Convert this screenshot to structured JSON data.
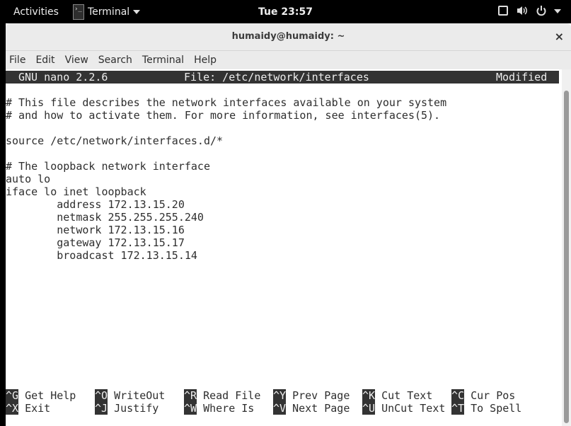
{
  "topbar": {
    "activities": "Activities",
    "app_name": "Terminal",
    "clock": "Tue 23:57",
    "icons": [
      "window-icon",
      "volume-icon",
      "power-icon",
      "dropdown-caret-icon"
    ]
  },
  "window": {
    "title": "humaidy@humaidy: ~",
    "close": "×"
  },
  "menu": [
    "File",
    "Edit",
    "View",
    "Search",
    "Terminal",
    "Help"
  ],
  "nano": {
    "version": "GNU nano 2.2.6",
    "file": "File: /etc/network/interfaces",
    "status": "Modified",
    "lines": [
      "# This file describes the network interfaces available on your system",
      "# and how to activate them. For more information, see interfaces(5).",
      "",
      "source /etc/network/interfaces.d/*",
      "",
      "# The loopback network interface",
      "auto lo",
      "iface lo inet loopback",
      "        address 172.13.15.20",
      "        netmask 255.255.255.240",
      "        network 172.13.15.16",
      "        gateway 172.13.15.17",
      "        broadcast 172.13.15.14"
    ],
    "help": [
      [
        {
          "key": "^G",
          "label": "Get Help"
        },
        {
          "key": "^O",
          "label": "WriteOut"
        },
        {
          "key": "^R",
          "label": "Read File"
        },
        {
          "key": "^Y",
          "label": "Prev Page"
        },
        {
          "key": "^K",
          "label": "Cut Text"
        },
        {
          "key": "^C",
          "label": "Cur Pos"
        }
      ],
      [
        {
          "key": "^X",
          "label": "Exit"
        },
        {
          "key": "^J",
          "label": "Justify"
        },
        {
          "key": "^W",
          "label": "Where Is"
        },
        {
          "key": "^V",
          "label": "Next Page"
        },
        {
          "key": "^U",
          "label": "UnCut Text"
        },
        {
          "key": "^T",
          "label": "To Spell"
        }
      ]
    ]
  }
}
